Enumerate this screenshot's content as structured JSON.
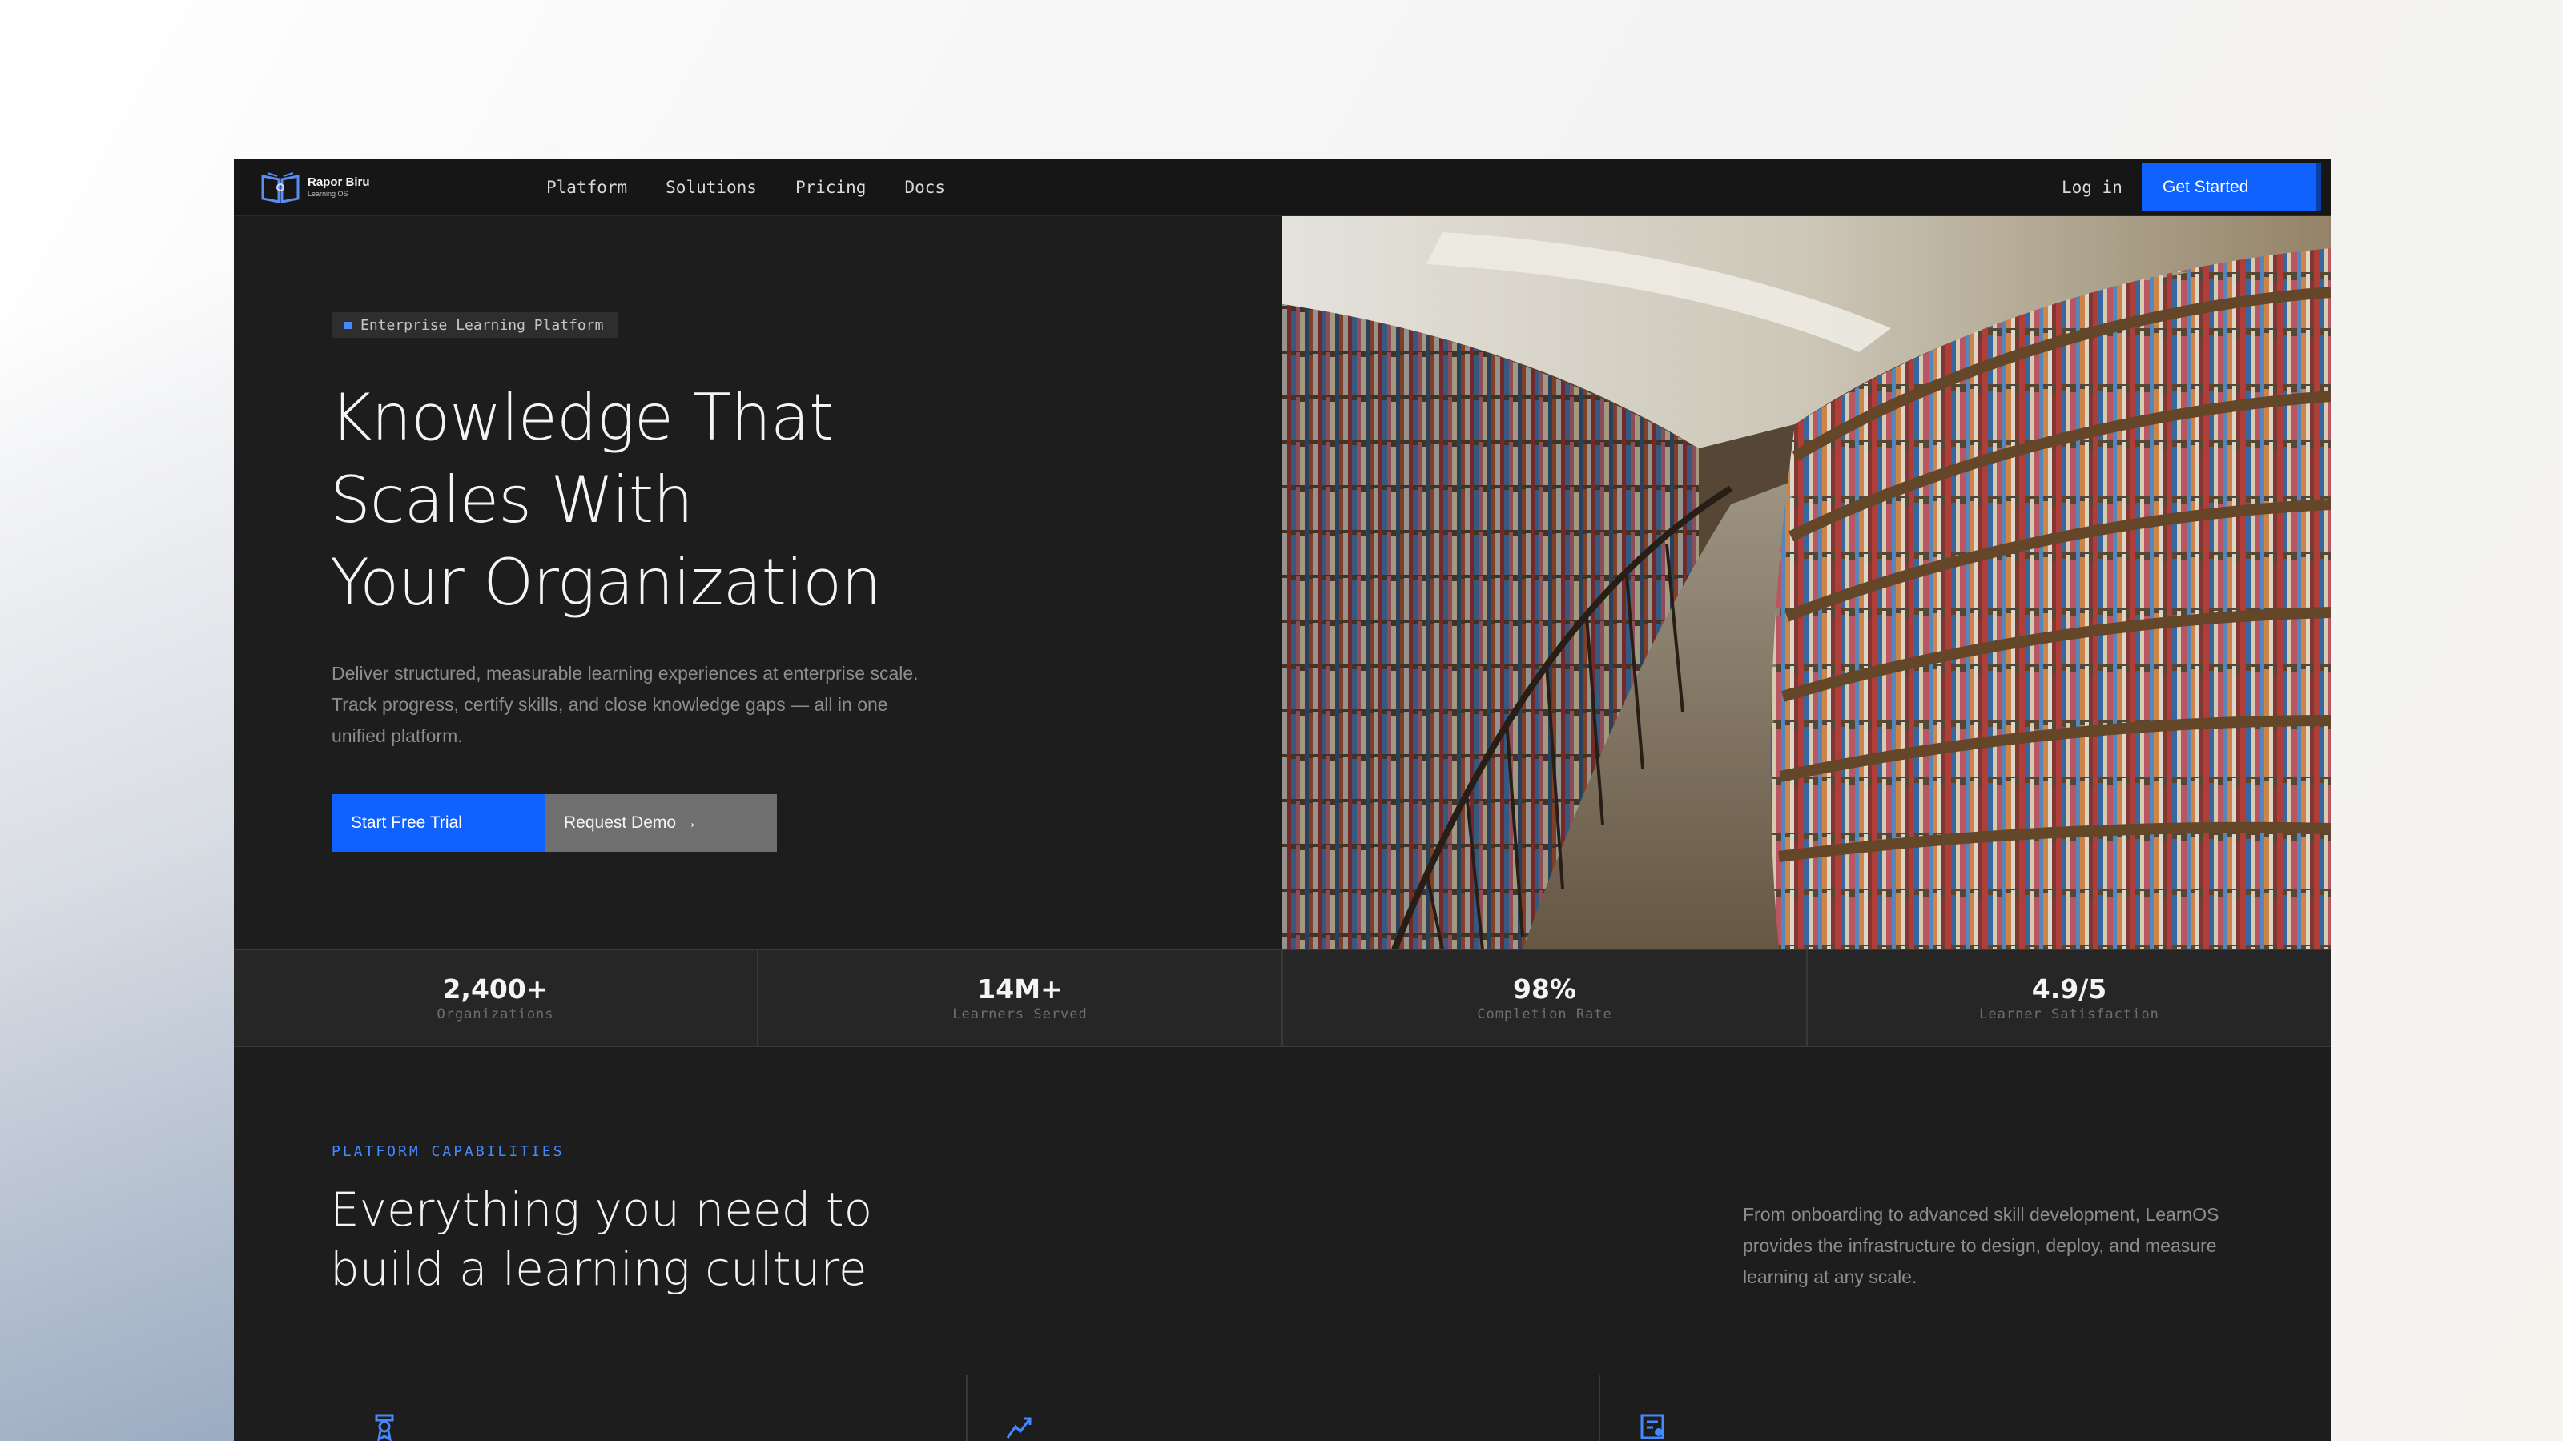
{
  "brand": {
    "name": "Rapor Biru",
    "tagline": "Learning OS",
    "logo_icon": "open-book-icon"
  },
  "nav": {
    "links": [
      "Platform",
      "Solutions",
      "Pricing",
      "Docs"
    ],
    "login_label": "Log in",
    "cta_label": "Get Started"
  },
  "hero": {
    "eyebrow": "Enterprise Learning Platform",
    "headline": [
      "Knowledge That",
      "Scales With",
      "Your Organization"
    ],
    "description": "Deliver structured, measurable learning experiences at enterprise scale. Track progress, certify skills, and close knowledge gaps — all in one unified platform.",
    "primary_cta": "Start Free Trial",
    "secondary_cta": "Request Demo →",
    "image": "library-bookshelves-photo"
  },
  "stats": [
    {
      "value": "2,400+",
      "label": "Organizations"
    },
    {
      "value": "14M+",
      "label": "Learners Served"
    },
    {
      "value": "98%",
      "label": "Completion Rate"
    },
    {
      "value": "4.9/5",
      "label": "Learner Satisfaction"
    }
  ],
  "capabilities": {
    "eyebrow": "PLATFORM CAPABILITIES",
    "title": [
      "Everything you need to",
      "build a learning culture"
    ],
    "description": "From onboarding to advanced skill development, LearnOS provides the infrastructure to design, deploy, and measure learning at any scale.",
    "feature_icons": [
      "certificate-icon",
      "trend-chart-icon",
      "report-icon"
    ]
  },
  "colors": {
    "accent": "#0f62fe",
    "accent_text": "#4589ff",
    "background": "#1d1d1d",
    "nav_background": "#161616",
    "stats_background": "#262626"
  }
}
